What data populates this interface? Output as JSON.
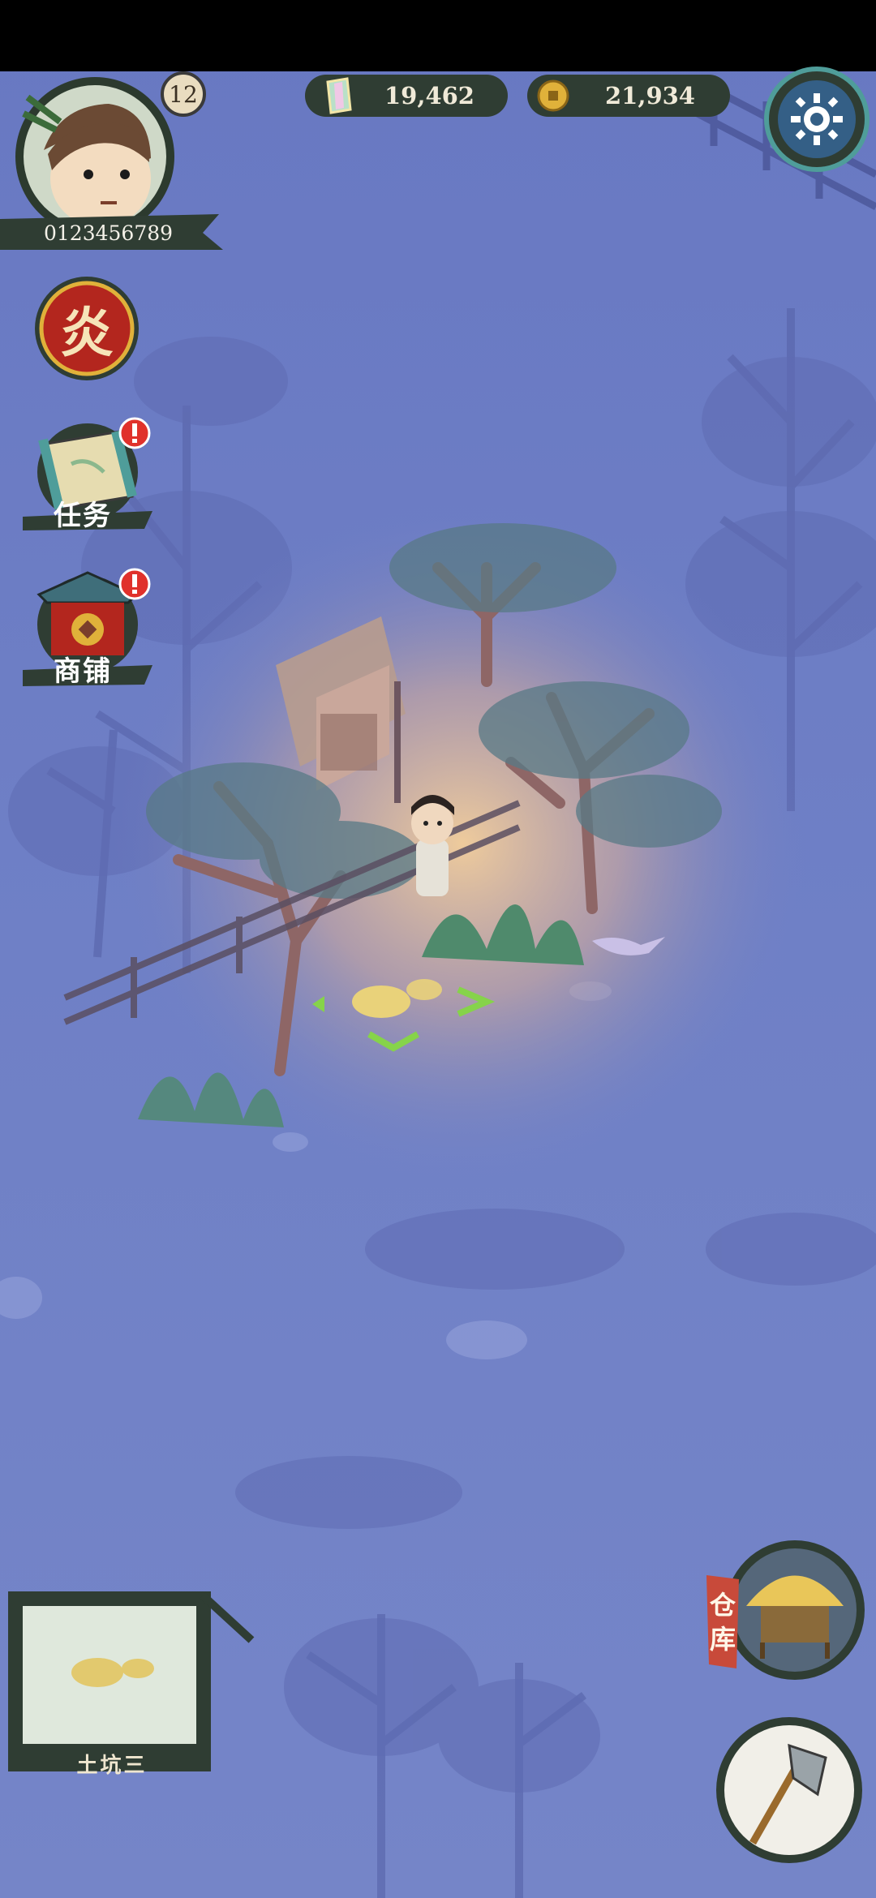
{
  "player": {
    "level": "12",
    "id": "0123456789"
  },
  "currency": {
    "gems": "19,462",
    "coins": "21,934"
  },
  "menu": {
    "disaster_glyph": "炎",
    "tasks_label": "任务",
    "shop_label": "商铺"
  },
  "selected_spot": {
    "label": "土坑三"
  },
  "warehouse": {
    "label_top": "仓",
    "label_bottom": "库"
  },
  "icons": [
    "settings-gear-icon",
    "gem-icon",
    "coin-icon",
    "alert-icon",
    "axe-icon",
    "warehouse-hut-icon",
    "scroll-map-icon",
    "shop-building-icon"
  ],
  "colors": {
    "fog": "#6f7fc4",
    "glow": "#f2c48a",
    "accent_red": "#b3261e",
    "panel_dark": "#2f3d33"
  }
}
